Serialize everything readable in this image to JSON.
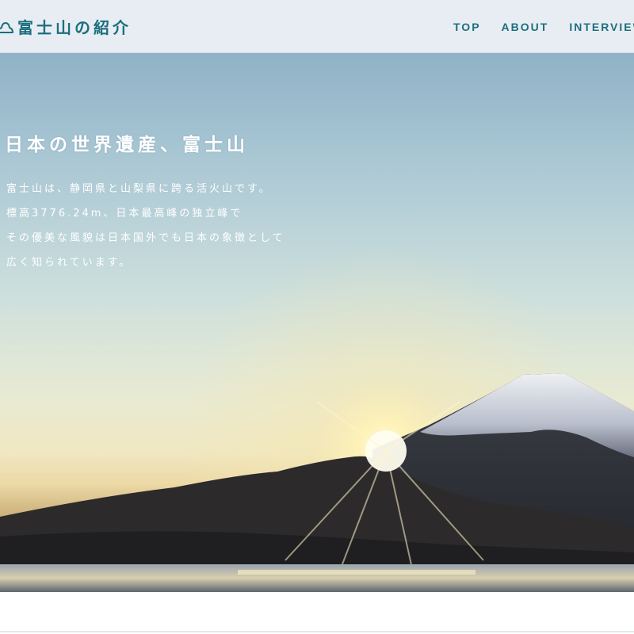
{
  "header": {
    "logo_text": "富士山の紹介",
    "logo_icon": "mountain-outline-icon",
    "nav": [
      {
        "label": "TOP"
      },
      {
        "label": "ABOUT"
      },
      {
        "label": "INTERVIEW"
      }
    ]
  },
  "hero": {
    "title": "日本の世界遺産、富士山",
    "lines": [
      "富士山は、静岡県と山梨県に跨る活火山です。",
      "標高3776.24m、日本最高峰の独立峰で",
      "その優美な風貌は日本国外でも日本の象徴として",
      "広く知られています。"
    ]
  },
  "colors": {
    "brand": "#1c6f7d",
    "header_bg": "#e8edf3"
  }
}
